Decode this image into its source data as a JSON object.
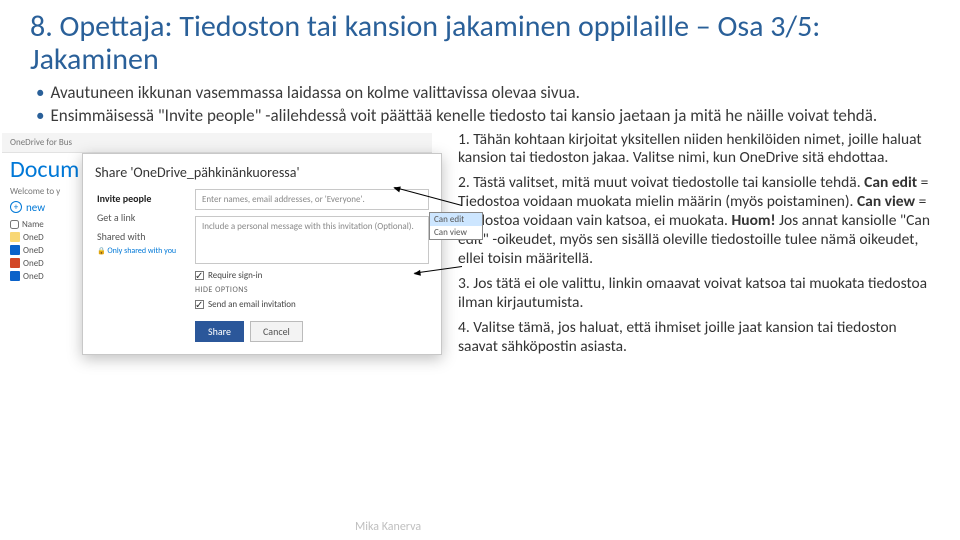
{
  "title": "8. Opettaja: Tiedoston tai kansion jakaminen oppilaille – Osa 3/5: Jakaminen",
  "bullets": [
    "Avautuneen ikkunan vasemmassa laidassa on kolme valittavissa olevaa sivua.",
    "Ensimmäisessä \"Invite people\" -alilehdesså voit päättää kenelle tiedosto tai kansio jaetaan ja mitä he näille voivat tehdä."
  ],
  "instructions": {
    "p1_lead": "1.",
    "p1": "Tähän kohtaan kirjoitat yksitellen niiden henkilöiden nimet, joille haluat kansion tai tiedoston jakaa. Valitse nimi, kun OneDrive sitä ehdottaa.",
    "p2_lead": "2.",
    "p2a": "Tästä valitset, mitä muut voivat tiedostolle tai kansiolle tehdä. ",
    "p2_canedit_l": "Can edit",
    "p2_canedit_t": " = Tiedostoa voidaan muokata mielin määrin (myös poistaminen). ",
    "p2_canview_l": "Can view",
    "p2_canview_t": " = Tiedostoa voidaan vain katsoa, ei muokata. ",
    "p2_huom_l": "Huom!",
    "p2_huom_t": " Jos annat kansiolle \"Can edit\" -oikeudet, myös sen sisällä oleville tiedostoille tulee nämä oikeudet, ellei toisin määritellä.",
    "p3_lead": "3.",
    "p3": "Jos tätä ei ole valittu, linkin omaavat voivat katsoa tai muokata tiedostoa ilman kirjautumista.",
    "p4_lead": "4.",
    "p4": "Valitse tämä, jos haluat, että ihmiset joille jaat kansion tai tiedoston saavat sähköpostin asiasta."
  },
  "dialog": {
    "title": "Share 'OneDrive_pähkinänkuoressa'",
    "tabs": {
      "invite": "Invite people",
      "getlink": "Get a link",
      "shared": "Shared with"
    },
    "only_shared": "Only shared with you",
    "name_placeholder": "Enter names, email addresses, or 'Everyone'.",
    "msg_placeholder": "Include a personal message with this invitation (Optional).",
    "perm": {
      "edit": "Can edit",
      "view": "Can view"
    },
    "require_signin": "Require sign-in",
    "hide_options": "HIDE OPTIONS",
    "send_email": "Send an email invitation",
    "share_btn": "Share",
    "cancel_btn": "Cancel"
  },
  "page": {
    "onedrive": "OneDrive for Bus",
    "docu": "Docum",
    "welcome": "Welcome to y",
    "new": "new",
    "header_name": "Name",
    "rows": [
      "OneD",
      "OneD",
      "OneD",
      "OneD"
    ]
  },
  "author": "Mika Kanerva"
}
